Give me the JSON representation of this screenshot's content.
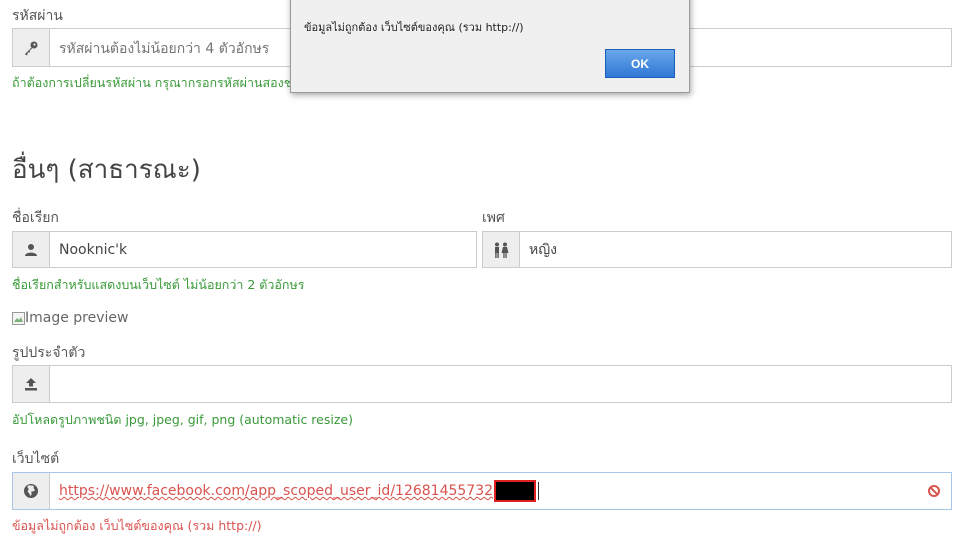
{
  "password": {
    "label": "รหัสผ่าน",
    "placeholder": "รหัสผ่านต้องไม่น้อยกว่า 4 ตัวอักษร",
    "help": "ถ้าต้องการเปลี่ยนรหัสผ่าน กรุณากรอกรหัสผ่านสองช่อ"
  },
  "section": {
    "title": "อื่นๆ (สาธารณะ)"
  },
  "nickname": {
    "label": "ชื่อเรียก",
    "value": "Nooknic'k",
    "help": "ชื่อเรียกสำหรับแสดงบนเว็บไซต์ ไม่น้อยกว่า 2 ตัวอักษร",
    "icon": "user-icon"
  },
  "gender": {
    "label": "เพศ",
    "value": "หญิง",
    "icon": "gender-icon"
  },
  "avatar": {
    "image_alt": "Image preview",
    "label": "รูปประจำตัว",
    "help": "อัปโหลดรูปภาพชนิด jpg, jpeg, gif, png (automatic resize)",
    "icon": "upload-icon"
  },
  "website": {
    "label": "เว็บไซต์",
    "value": "https://www.facebook.com/app_scoped_user_id/12681455732",
    "error": "ข้อมูลไม่ถูกต้อง เว็บไซต์ของคุณ (รวม http://)",
    "icon": "globe-icon",
    "error_color": "#d9534f"
  },
  "alert": {
    "message": "ข้อมูลไม่ถูกต้อง เว็บไซต์ของคุณ (รวม http://)",
    "ok_label": "OK"
  },
  "colors": {
    "help_green": "#3a9a3a",
    "error_red": "#d9534f",
    "button_blue": "#2f78d6"
  }
}
